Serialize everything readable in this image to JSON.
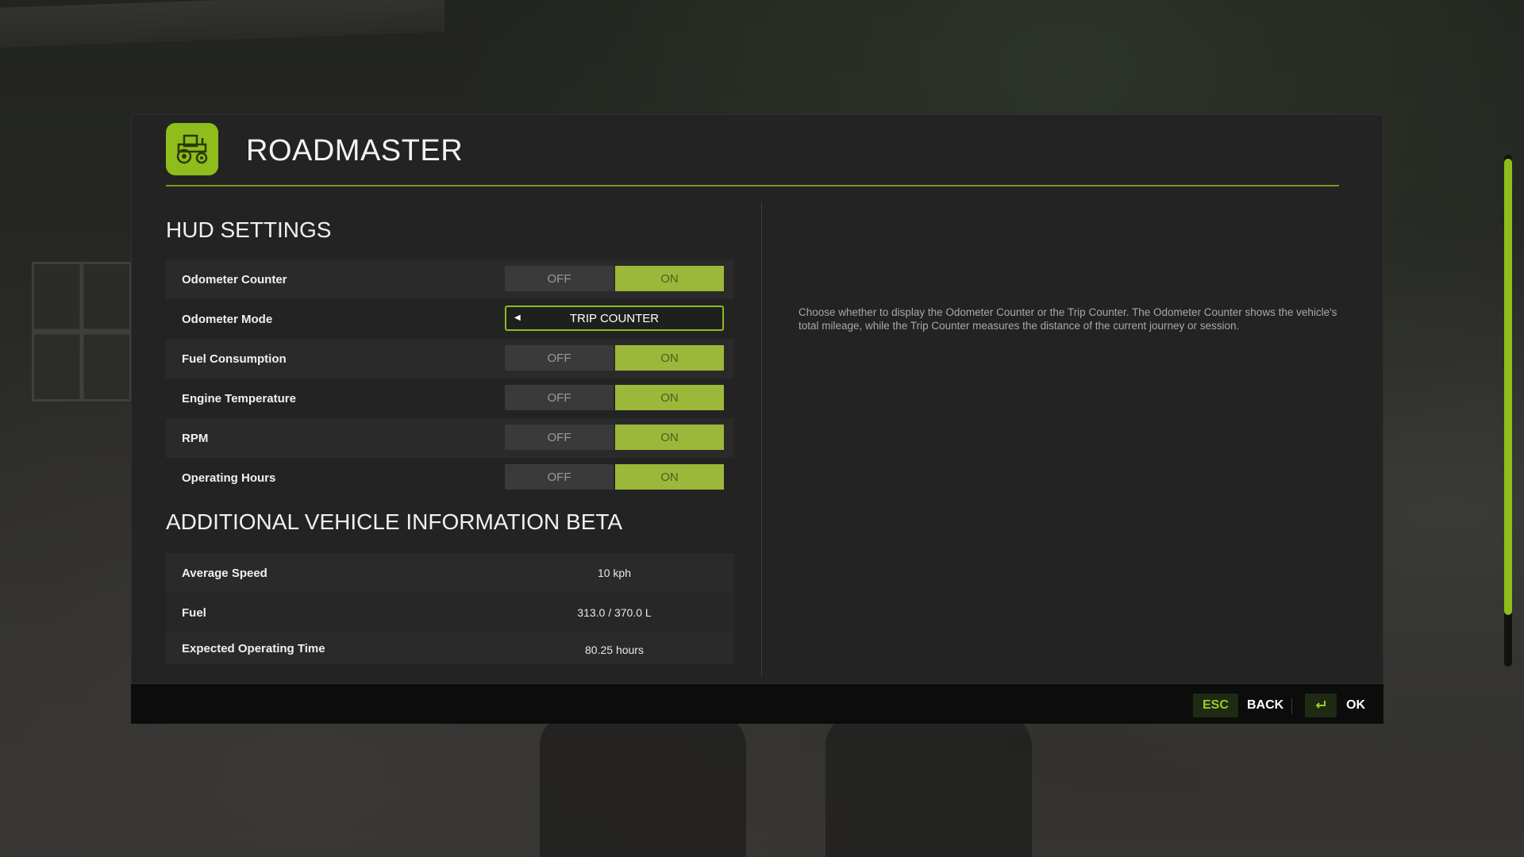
{
  "dialog": {
    "title": "ROADMASTER",
    "logo_icon": "tractor-icon",
    "accent_color": "#8fbd1c"
  },
  "hud_settings": {
    "heading": "HUD SETTINGS",
    "rows": [
      {
        "label": "Odometer Counter",
        "type": "toggle",
        "off_label": "OFF",
        "on_label": "ON",
        "value": "ON"
      },
      {
        "label": "Odometer Mode",
        "type": "selector",
        "value": "TRIP COUNTER"
      },
      {
        "label": "Fuel Consumption",
        "type": "toggle",
        "off_label": "OFF",
        "on_label": "ON",
        "value": "ON"
      },
      {
        "label": "Engine Temperature",
        "type": "toggle",
        "off_label": "OFF",
        "on_label": "ON",
        "value": "ON"
      },
      {
        "label": "RPM",
        "type": "toggle",
        "off_label": "OFF",
        "on_label": "ON",
        "value": "ON"
      },
      {
        "label": "Operating Hours",
        "type": "toggle",
        "off_label": "OFF",
        "on_label": "ON",
        "value": "ON"
      }
    ]
  },
  "vehicle_info": {
    "heading": "ADDITIONAL VEHICLE INFORMATION BETA",
    "rows": [
      {
        "label": "Average Speed",
        "value": "10 kph"
      },
      {
        "label": "Fuel",
        "value": "313.0 / 370.0 L"
      },
      {
        "label": "Expected Operating Time",
        "value": "80.25 hours"
      }
    ]
  },
  "description": "Choose whether to display the Odometer Counter or the Trip Counter. The Odometer Counter shows the vehicle's total mileage, while the Trip Counter measures the distance of the current journey or session.",
  "footer": {
    "esc_key": "ESC",
    "back_label": "BACK",
    "enter_icon": "enter-icon",
    "ok_label": "OK"
  },
  "scrollbar": {
    "position_fraction": 0.9
  }
}
